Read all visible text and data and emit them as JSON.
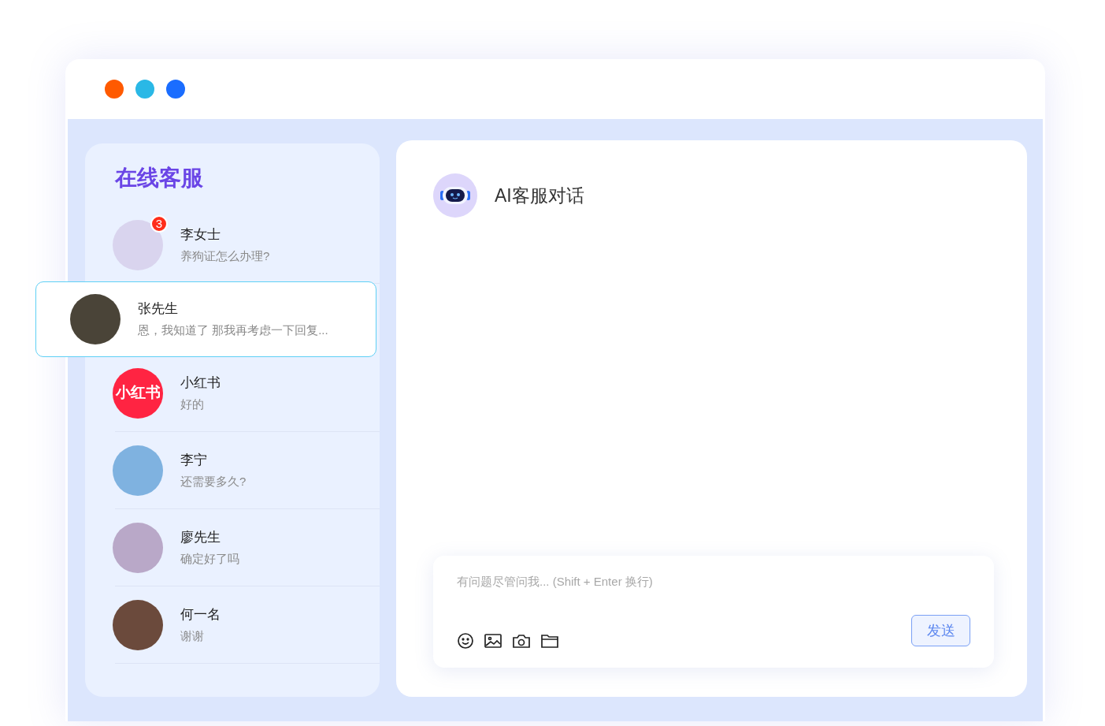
{
  "sidebar": {
    "title": "在线客服",
    "contacts": [
      {
        "name": "李女士",
        "message": "养狗证怎么办理?",
        "badge": "3",
        "selected": false,
        "avatar": {
          "kind": "photo",
          "color": "#d9d4ee"
        }
      },
      {
        "name": "张先生",
        "message": "恩，我知道了 那我再考虑一下回复...",
        "selected": true,
        "avatar": {
          "kind": "photo",
          "color": "#4a4438"
        }
      },
      {
        "name": "小红书",
        "message": "好的",
        "selected": false,
        "avatar": {
          "kind": "logo",
          "text": "小红书",
          "color": "#ff2442"
        }
      },
      {
        "name": "李宁",
        "message": "还需要多久?",
        "selected": false,
        "avatar": {
          "kind": "photo",
          "color": "#7fb2e0"
        }
      },
      {
        "name": "廖先生",
        "message": "确定好了吗",
        "selected": false,
        "avatar": {
          "kind": "photo",
          "color": "#b9a8c8"
        }
      },
      {
        "name": "何一名",
        "message": "谢谢",
        "selected": false,
        "avatar": {
          "kind": "photo",
          "color": "#6b4a3c"
        }
      }
    ]
  },
  "chat": {
    "title": "AI客服对话",
    "composer": {
      "placeholder": "有问题尽管问我... (Shift + Enter 换行)",
      "send_button": "发送"
    }
  }
}
